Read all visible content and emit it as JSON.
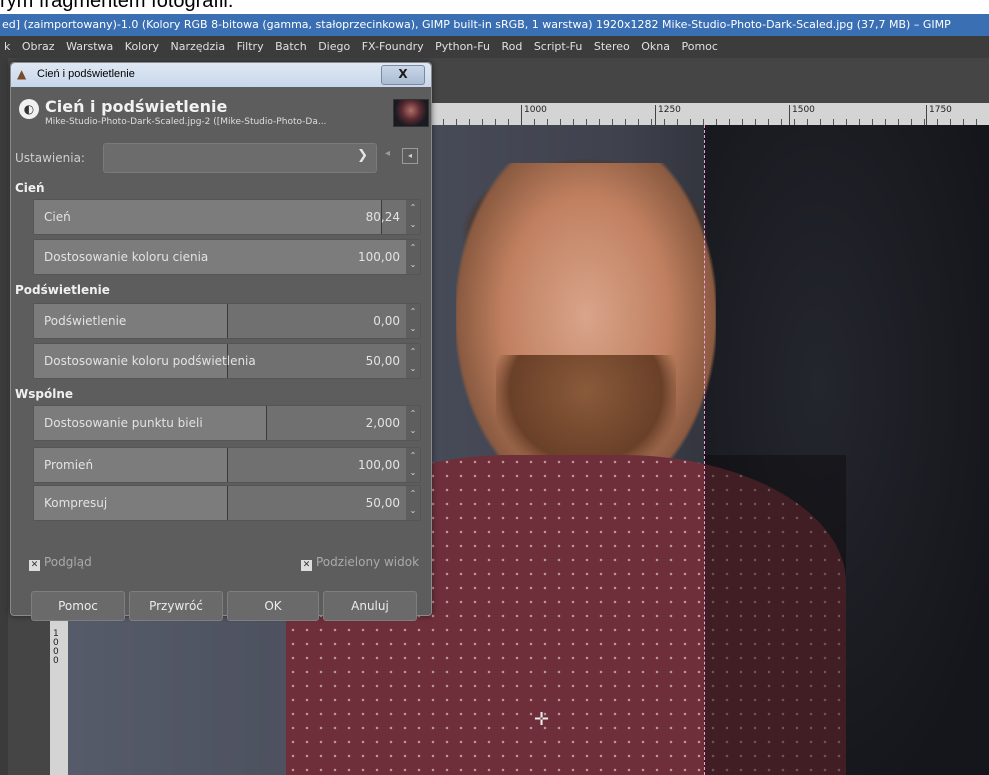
{
  "caption_top": "rym fragmentem fotografii.",
  "window_title": "ed] (zaimportowany)-1.0 (Kolory RGB 8-bitowa (gamma, stałoprzecinkowa), GIMP built-in sRGB, 1 warstwa) 1920x1282 Mike-Studio-Photo-Dark-Scaled.jpg (37,7 MB) – GIMP",
  "menu": [
    "k",
    "Obraz",
    "Warstwa",
    "Kolory",
    "Narzędzia",
    "Filtry",
    "Batch",
    "Diego",
    "FX-Foundry",
    "Python-Fu",
    "Rod",
    "Script-Fu",
    "Stereo",
    "Okna",
    "Pomoc"
  ],
  "ruler_h": [
    "1000",
    "1250",
    "1500",
    "1750"
  ],
  "ruler_v": "1000",
  "dialog": {
    "window_title": "Cień i podświetlenie",
    "close": "X",
    "header_title": "Cień i podświetlenie",
    "header_subtitle": "Mike-Studio-Photo-Dark-Scaled.jpg-2 ([Mike-Studio-Photo-Da...",
    "presets_label": "Ustawienia:",
    "presets_value": "",
    "sections": {
      "shadows": "Cień",
      "highlights": "Podświetlenie",
      "common": "Wspólne"
    },
    "sliders": [
      {
        "label": "Cień",
        "value": "80,24",
        "fraction": 0.9
      },
      {
        "label": "Dostosowanie koloru cienia",
        "value": "100,00",
        "fraction": 1.0
      },
      {
        "label": "Podświetlenie",
        "value": "0,00",
        "fraction": 0.5
      },
      {
        "label": "Dostosowanie koloru podświetlenia",
        "value": "50,00",
        "fraction": 0.5
      },
      {
        "label": "Dostosowanie punktu bieli",
        "value": "2,000",
        "fraction": 0.6
      },
      {
        "label": "Promień",
        "value": "100,00",
        "fraction": 0.5
      },
      {
        "label": "Kompresuj",
        "value": "50,00",
        "fraction": 0.5
      }
    ],
    "preview_label": "Podgląd",
    "split_label": "Podzielony widok",
    "buttons": {
      "help": "Pomoc",
      "reset": "Przywróć",
      "ok": "OK",
      "cancel": "Anuluj"
    }
  }
}
